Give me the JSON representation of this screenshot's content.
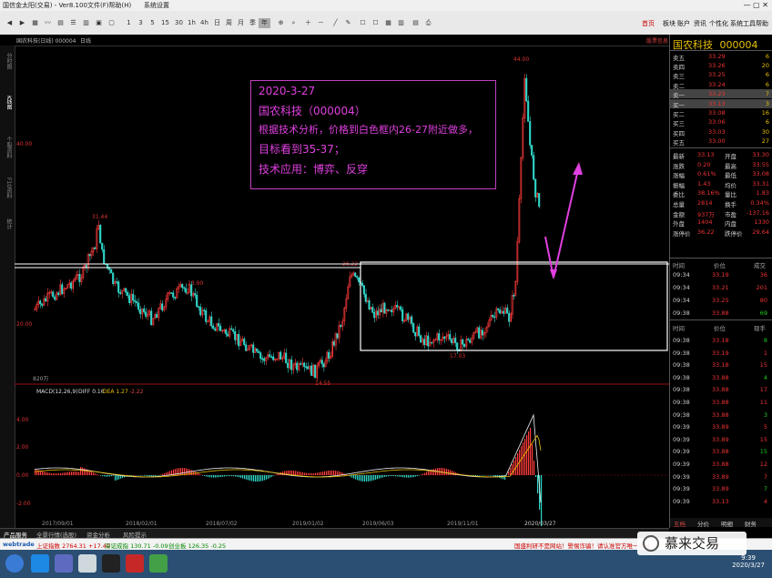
{
  "window": {
    "app_title": "国信金太阳(交易) - Ver8.100",
    "menu_items": [
      "文件(F)帮助(H)",
      "系统设置"
    ]
  },
  "toolbar": {
    "periods": [
      "1",
      "3",
      "5",
      "15",
      "30",
      "1h",
      "4h",
      "日",
      "周",
      "月",
      "季",
      "年"
    ],
    "right_menu": [
      "首页",
      "板块",
      "账户",
      "资讯",
      "个性化",
      "系统工具",
      "帮助"
    ]
  },
  "subheader": {
    "symbol_text": "国农科技(日线) 000004",
    "period_label": "日线",
    "right_link": "股票信息"
  },
  "left_tabs": [
    "分时图",
    "K线图",
    "个股资料",
    "F10资料",
    "统计"
  ],
  "main_chart": {
    "price_labels": [
      "40.00",
      "20.00"
    ],
    "peak_labels": [
      "44.00",
      "31.44",
      "26.22",
      "23.90",
      "17.03",
      "14.55"
    ],
    "volume_note": "820万",
    "box_color": "#ffffff"
  },
  "macd": {
    "title": "MACD(12,26,9)",
    "diff_label": "DIFF 0.16",
    "dea_label": "DEA 1.27",
    "macd_label": "-2.22",
    "y_labels": [
      "4.00",
      "2.00",
      "0.00",
      "-2.00"
    ]
  },
  "x_axis_dates": [
    "2017/09/01",
    "2018/02/01",
    "2018/07/02",
    "2019/01/02",
    "2019/06/03",
    "2019/11/01",
    "2020/03/27"
  ],
  "annotation": {
    "line1": "2020-3-27",
    "line2": "国农科技（000004）",
    "line3": "根据技术分析，价格到白色框内26-27附近做多，",
    "line4": "目标看到35-37；",
    "line5": "技术应用：博弈、反穿",
    "color": "#e040e0"
  },
  "right_panel": {
    "stock_name": "国农科技",
    "stock_code": "000004",
    "order_book": [
      {
        "label": "卖五",
        "price": "33.29",
        "vol": "6"
      },
      {
        "label": "卖四",
        "price": "33.26",
        "vol": "20"
      },
      {
        "label": "卖三",
        "price": "33.25",
        "vol": "6"
      },
      {
        "label": "卖二",
        "price": "33.24",
        "vol": "6"
      },
      {
        "label": "卖一",
        "price": "33.23",
        "vol": "7"
      },
      {
        "label": "买一",
        "price": "33.13",
        "vol": "3"
      },
      {
        "label": "买二",
        "price": "33.08",
        "vol": "16"
      },
      {
        "label": "买三",
        "price": "33.06",
        "vol": "6"
      },
      {
        "label": "买四",
        "price": "33.03",
        "vol": "30"
      },
      {
        "label": "买五",
        "price": "33.00",
        "vol": "27"
      }
    ],
    "stats": [
      {
        "l1": "最新",
        "v1": "33.13",
        "l2": "开盘",
        "v2": "33.30"
      },
      {
        "l1": "涨跌",
        "v1": "0.20",
        "l2": "最高",
        "v2": "33.55"
      },
      {
        "l1": "涨幅",
        "v1": "0.61%",
        "l2": "最低",
        "v2": "33.08"
      },
      {
        "l1": "振幅",
        "v1": "1.43",
        "l2": "均价",
        "v2": "33.31"
      },
      {
        "l1": "委比",
        "v1": "38.16%",
        "l2": "量比",
        "v2": "1.83"
      },
      {
        "l1": "总量",
        "v1": "2814",
        "l2": "换手",
        "v2": "0.34%"
      },
      {
        "l1": "金额",
        "v1": "937万",
        "l2": "市盈",
        "v2": "-137.16"
      },
      {
        "l1": "外盘",
        "v1": "1404",
        "l2": "内盘",
        "v2": "1330"
      },
      {
        "l1": "涨停价",
        "v1": "36.22",
        "l2": "跌停价",
        "v2": "29.64"
      }
    ],
    "ticks_header": [
      "时间",
      "价位",
      "成交"
    ],
    "ticks_top": [
      {
        "t": "09:34",
        "p": "33.19",
        "v": "36"
      },
      {
        "t": "09:34",
        "p": "33.21",
        "v": "201"
      },
      {
        "t": "09:34",
        "p": "33.25",
        "v": "80"
      },
      {
        "t": "09:38",
        "p": "33.88",
        "v": "69"
      }
    ],
    "ticks_header2": [
      "时间",
      "价位",
      "现手"
    ],
    "ticks": [
      {
        "t": "09:38",
        "p": "33.18",
        "v": "8"
      },
      {
        "t": "09:38",
        "p": "33.19",
        "v": "1"
      },
      {
        "t": "09:38",
        "p": "33.18",
        "v": "15"
      },
      {
        "t": "09:38",
        "p": "33.88",
        "v": "4"
      },
      {
        "t": "09:38",
        "p": "33.88",
        "v": "17"
      },
      {
        "t": "09:38",
        "p": "33.88",
        "v": "11"
      },
      {
        "t": "09:38",
        "p": "33.88",
        "v": "3"
      },
      {
        "t": "09:39",
        "p": "33.89",
        "v": "5"
      },
      {
        "t": "09:39",
        "p": "33.89",
        "v": "15"
      },
      {
        "t": "09:39",
        "p": "33.88",
        "v": "15"
      },
      {
        "t": "09:39",
        "p": "33.88",
        "v": "12"
      },
      {
        "t": "09:39",
        "p": "33.89",
        "v": "7"
      },
      {
        "t": "09:39",
        "p": "33.89",
        "v": "7"
      },
      {
        "t": "09:39",
        "p": "33.13",
        "v": "4"
      }
    ],
    "tabs": [
      "五档",
      "分价",
      "明细",
      "财务"
    ]
  },
  "bottom_tabs": [
    "产品服务",
    "全景行情(选股)",
    "资金分析",
    "风险提示"
  ],
  "status": {
    "index1": "上证指数 2764.31 +17.40",
    "index2": "深证成指 130.71 -0.09",
    "index3": "创业板 126.35 -0.25",
    "ticker": "国盛利研不是网站！警惕诈骗！请认准官方唯一渠道",
    "brand": "webtrade"
  },
  "watermark": {
    "text": "慕来交易"
  },
  "taskbar": {
    "time": "9:39",
    "date": "2020/3/27"
  }
}
